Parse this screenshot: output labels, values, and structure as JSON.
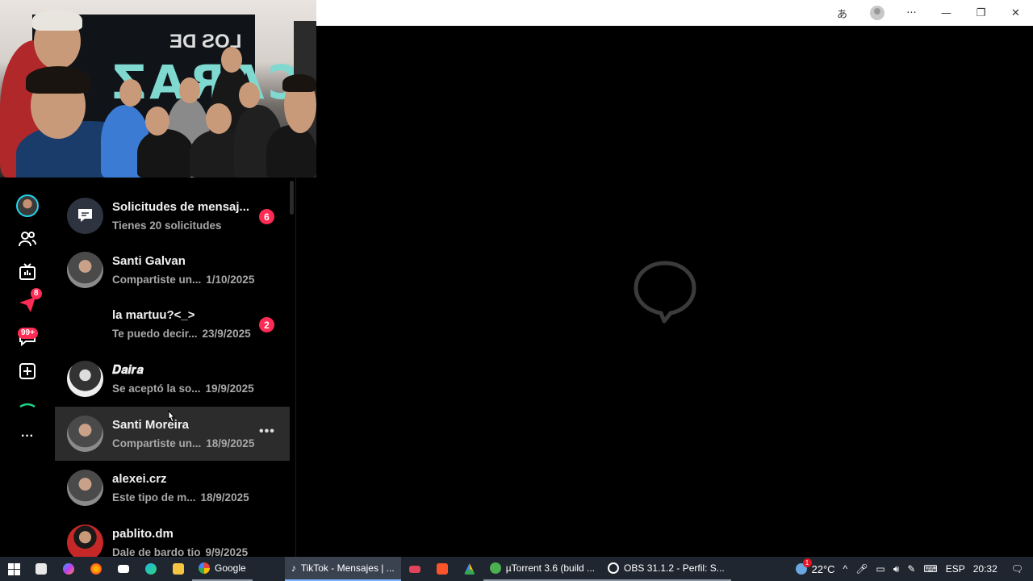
{
  "titlebar": {
    "translate_icon": "あ",
    "more_icon": "···",
    "minimize": "—",
    "restore": "❐",
    "close": "✕"
  },
  "webcam": {
    "banner_text": "CARAZ",
    "banner_small": "LOS DE"
  },
  "nav": {
    "badges": {
      "inbox_badge": "8",
      "messages_badge": "99+"
    },
    "more": "···"
  },
  "conversations": [
    {
      "name": "Solicitudes de mensaj...",
      "subtitle": "Tienes 20 solicitudes",
      "date": "",
      "badge": "6",
      "avatar": "requests"
    },
    {
      "name": "Santi Galvan",
      "subtitle": "Compartiste un...",
      "date": "1/10/2025",
      "badge": "",
      "avatar": "photo"
    },
    {
      "name": "la martuu?<_>",
      "subtitle": "Te puedo decir...",
      "date": "23/9/2025",
      "badge": "2",
      "avatar": "none"
    },
    {
      "name": "𝑫𝒂𝒊𝒓𝒂",
      "subtitle": "Se aceptó la so...",
      "date": "19/9/2025",
      "badge": "",
      "avatar": "bw"
    },
    {
      "name": "Santi Moreira",
      "subtitle": "Compartiste un...",
      "date": "18/9/2025",
      "badge": "",
      "avatar": "photo",
      "active": true,
      "more": "•••"
    },
    {
      "name": "alexei.crz",
      "subtitle": "Este tipo de m...",
      "date": "18/9/2025",
      "badge": "",
      "avatar": "photo"
    },
    {
      "name": "pablito.dm",
      "subtitle": "Dale de bardo tio",
      "date": "9/9/2025",
      "badge": "",
      "avatar": "red"
    }
  ],
  "taskbar": {
    "apps": [
      {
        "label": "Google",
        "state": "open",
        "color": "#4285f4"
      },
      {
        "label": "TikTok - Mensajes | ...",
        "state": "active",
        "color": "#000000"
      },
      {
        "label": "µTorrent 3.6  (build ...",
        "state": "open",
        "color": "#4caf50"
      },
      {
        "label": "OBS 31.1.2 - Perfil: S...",
        "state": "open",
        "color": "#302e31"
      }
    ],
    "weather": "22°C",
    "weather_badge": "1",
    "language": "ESP",
    "time": "20:32"
  },
  "colors": {
    "accent": "#fe2c55",
    "teal": "#20d5ec",
    "active_row": "#2c2c2c",
    "taskbar": "#1f2630"
  }
}
